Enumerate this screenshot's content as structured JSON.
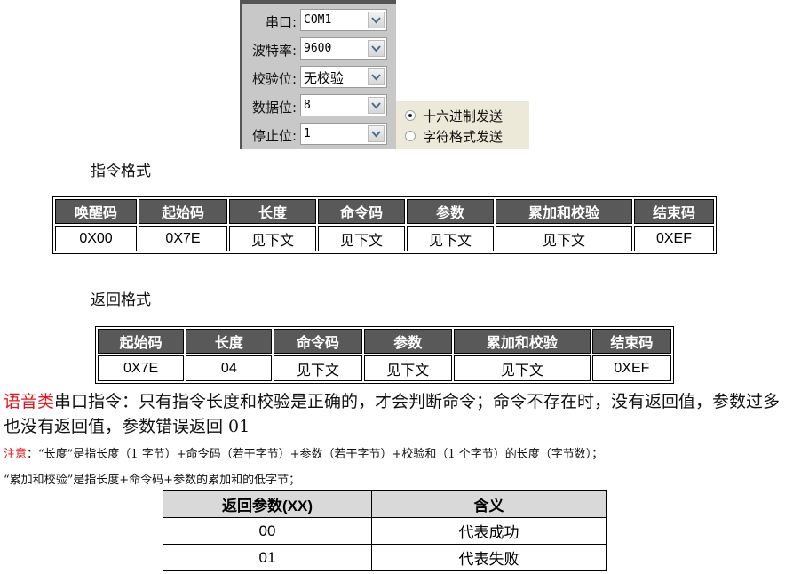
{
  "serial_panel": {
    "fields": [
      {
        "label": "串口:",
        "value": "COM1"
      },
      {
        "label": "波特率:",
        "value": "9600"
      },
      {
        "label": "校验位:",
        "value": "无校验"
      },
      {
        "label": "数据位:",
        "value": "8"
      },
      {
        "label": "停止位:",
        "value": "1"
      }
    ],
    "send_mode": {
      "options": [
        "十六进制发送",
        "字符格式发送"
      ],
      "selected": "十六进制发送"
    }
  },
  "command_format": {
    "heading": "指令格式",
    "headers": [
      "唤醒码",
      "起始码",
      "长度",
      "命令码",
      "参数",
      "累加和校验",
      "结束码"
    ],
    "values": [
      "0X00",
      "0X7E",
      "见下文",
      "见下文",
      "见下文",
      "见下文",
      "0XEF"
    ]
  },
  "return_format": {
    "heading": "返回格式",
    "headers": [
      "起始码",
      "长度",
      "命令码",
      "参数",
      "累加和校验",
      "结束码"
    ],
    "values": [
      "0X7E",
      "04",
      "见下文",
      "见下文",
      "见下文",
      "0XEF"
    ]
  },
  "description": {
    "highlight": "语音类",
    "text": "串口指令：只有指令长度和校验是正确的，才会判断命令；命令不存在时，没有返回值，参数过多也没有返回值，参数错误返回 01"
  },
  "notes": {
    "label": "注意",
    "line1": "：“长度”是指长度（1 字节）+命令码（若干字节）+参数（若干字节）+校验和（1 个字节）的长度（字节数）；",
    "line2": "“累加和校验”是指长度+命令码+参数的累加和的低字节；"
  },
  "return_params": {
    "headers": [
      "返回参数(XX)",
      "含义"
    ],
    "rows": [
      {
        "code": "00",
        "meaning": "代表成功"
      },
      {
        "code": "01",
        "meaning": "代表失败"
      }
    ]
  }
}
